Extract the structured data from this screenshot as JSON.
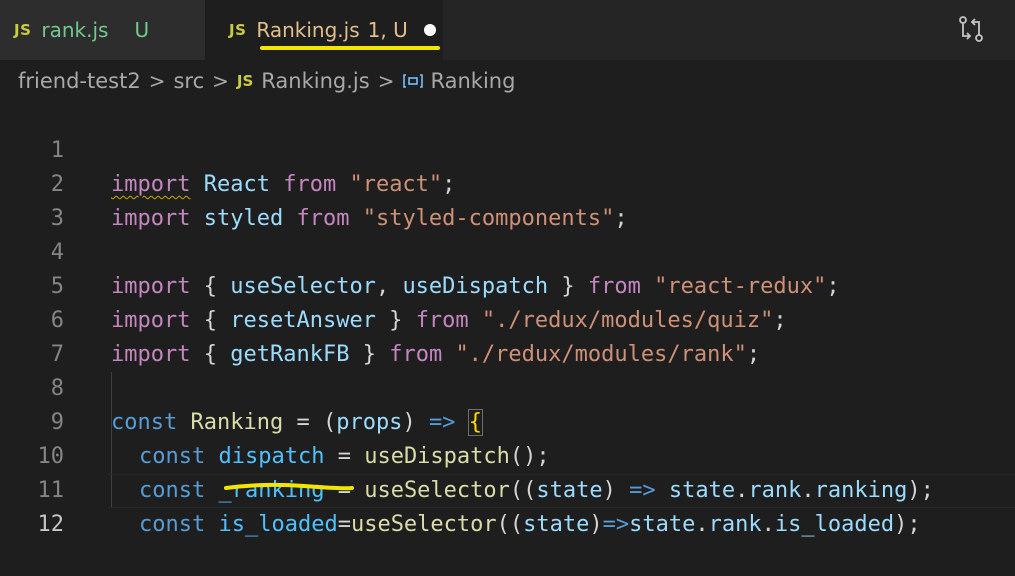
{
  "tabs": [
    {
      "badge": "JS",
      "name": "rank.js",
      "status": "U"
    },
    {
      "badge": "JS",
      "name": "Ranking.js",
      "status": "1, U"
    }
  ],
  "breadcrumb": {
    "folder1": "friend-test2",
    "sep": ">",
    "folder2": "src",
    "file_badge": "JS",
    "file": "Ranking.js",
    "symbol": "Ranking"
  },
  "icons": {
    "compare": "compare-changes-icon",
    "dirty": "unsaved-dot-icon",
    "symbol": "symbol-variable-icon"
  },
  "colors": {
    "annotation": "#f2e600",
    "keyword": "#c586c0",
    "string": "#ce9178",
    "variable": "#9cdcfe",
    "function": "#dcdcaa"
  },
  "code": {
    "line_numbers": [
      "1",
      "2",
      "3",
      "4",
      "5",
      "6",
      "7",
      "8",
      "9",
      "10",
      "11",
      "12"
    ],
    "l1": {
      "a": "import",
      "b": " ",
      "c": "React",
      "d": " ",
      "e": "from",
      "f": " ",
      "g": "\"react\"",
      "h": ";"
    },
    "l2": {
      "a": "import",
      "b": " ",
      "c": "styled",
      "d": " ",
      "e": "from",
      "f": " ",
      "g": "\"styled-components\"",
      "h": ";"
    },
    "l4": {
      "a": "import",
      "b": " { ",
      "c": "useSelector",
      "d": ", ",
      "e": "useDispatch",
      "f": " } ",
      "g": "from",
      "h": " ",
      "i": "\"react-redux\"",
      "j": ";"
    },
    "l5": {
      "a": "import",
      "b": " { ",
      "c": "resetAnswer",
      "d": " } ",
      "e": "from",
      "f": " ",
      "g": "\"./redux/modules/quiz\"",
      "h": ";"
    },
    "l6": {
      "a": "import",
      "b": " { ",
      "c": "getRankFB",
      "d": " } ",
      "e": "from",
      "f": " ",
      "g": "\"./redux/modules/rank\"",
      "h": ";"
    },
    "l8": {
      "a": "const",
      "b": " ",
      "c": "Ranking",
      "d": " = ",
      "e": "(",
      "f": "props",
      "g": ")",
      "h": " ",
      "i": "=>",
      "j": " ",
      "k": "{"
    },
    "l9": {
      "a": "const",
      "b": " ",
      "c": "dispatch",
      "d": " = ",
      "e": "useDispatch",
      "f": "();"
    },
    "l10": {
      "a": "const",
      "b": " ",
      "c": "_ranking",
      "d": " = ",
      "e": "useSelector",
      "f": "((",
      "g": "state",
      "h": ") ",
      "i": "=>",
      "j": " ",
      "k": "state",
      "l": ".",
      "m": "rank",
      "n": ".",
      "o": "ranking",
      "p": ");"
    },
    "l11": {
      "a": "const",
      "b": " ",
      "c": "is_loaded",
      "d": "=",
      "e": "useSelector",
      "f": "((",
      "g": "state",
      "h": ")",
      "i": "=>",
      "j": "state",
      "k": ".",
      "l": "rank",
      "m": ".",
      "n": "is_loaded",
      "o": ");"
    }
  }
}
